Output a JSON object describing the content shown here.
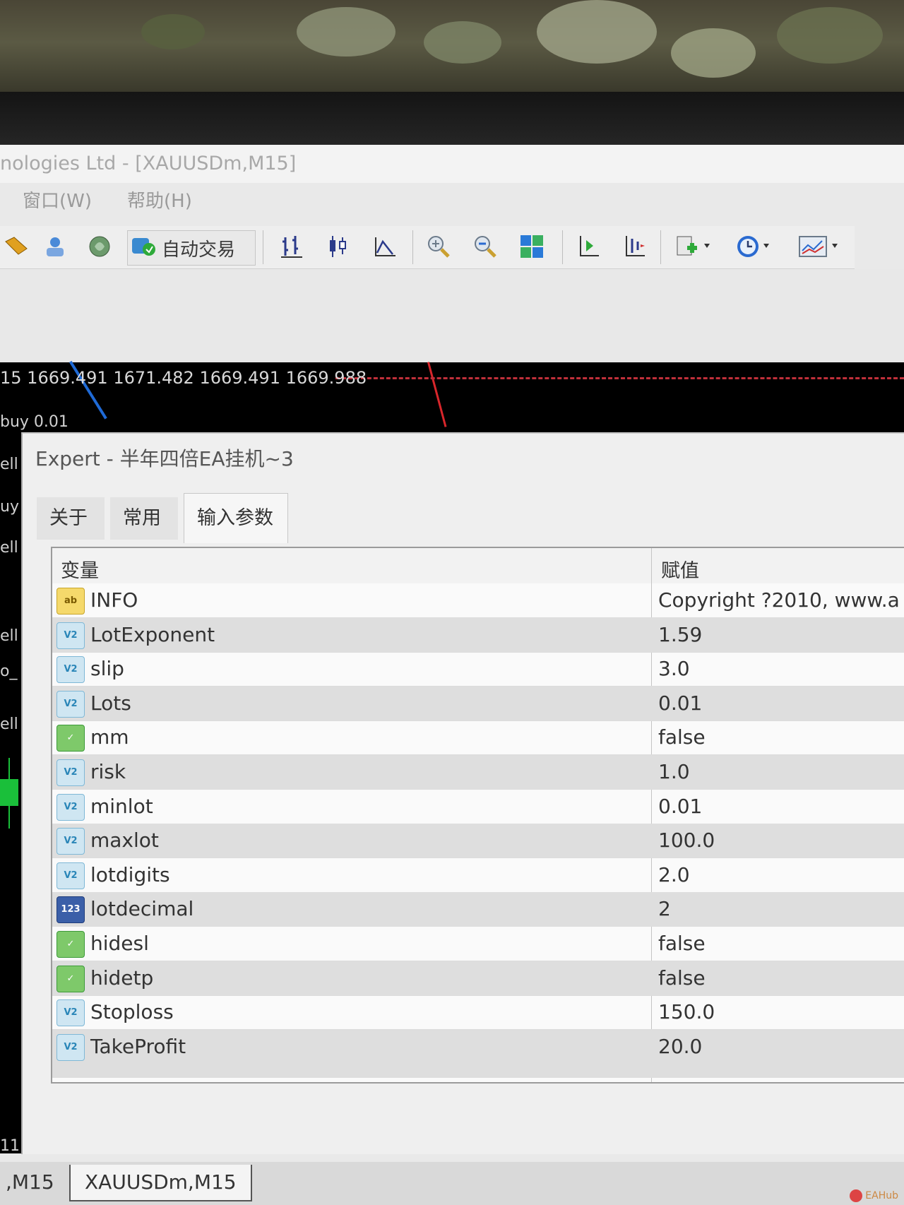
{
  "window": {
    "title": "nologies Ltd - [XAUUSDm,M15]",
    "menu": [
      "窗口(W)",
      "帮助(H)"
    ]
  },
  "toolbar": {
    "autotrade_label": "自动交易",
    "icons": [
      "folder-icon",
      "profile-icon",
      "globe-icon",
      "autotrade-icon",
      "bar-chart-icon",
      "candlestick-icon",
      "line-chart-icon",
      "zoom-in-icon",
      "zoom-out-icon",
      "tile-windows-icon",
      "chart-shift-icon",
      "autoscroll-icon",
      "new-order-icon",
      "clock-icon",
      "indicators-icon"
    ]
  },
  "chart": {
    "ohlc_text": "15 1669.491 1671.482 1669.491 1669.988",
    "labels": [
      "buy 0.01",
      "ell",
      "uy",
      "ell",
      "ell",
      "o_",
      "ell"
    ],
    "axis_label": "11"
  },
  "dialog": {
    "title": "Expert - 半年四倍EA挂机~3",
    "tabs": [
      "关于",
      "常用",
      "输入参数"
    ],
    "active_tab": "输入参数",
    "columns": [
      "变量",
      "赋值"
    ],
    "params": [
      {
        "type": "ab",
        "name": "INFO",
        "value": "Copyright ?2010, www.a"
      },
      {
        "type": "v2",
        "name": "LotExponent",
        "value": "1.59"
      },
      {
        "type": "v2",
        "name": "slip",
        "value": "3.0"
      },
      {
        "type": "v2",
        "name": "Lots",
        "value": "0.01"
      },
      {
        "type": "bool",
        "name": "mm",
        "value": "false"
      },
      {
        "type": "v2",
        "name": "risk",
        "value": "1.0"
      },
      {
        "type": "v2",
        "name": "minlot",
        "value": "0.01"
      },
      {
        "type": "v2",
        "name": "maxlot",
        "value": "100.0"
      },
      {
        "type": "v2",
        "name": "lotdigits",
        "value": "2.0"
      },
      {
        "type": "int",
        "name": "lotdecimal",
        "value": "2"
      },
      {
        "type": "bool",
        "name": "hidesl",
        "value": "false"
      },
      {
        "type": "bool",
        "name": "hidetp",
        "value": "false"
      },
      {
        "type": "v2",
        "name": "Stoploss",
        "value": "150.0"
      },
      {
        "type": "v2",
        "name": "TakeProfit",
        "value": "20.0"
      }
    ]
  },
  "bottom_tabs": [
    ",M15",
    "XAUUSDm,M15"
  ],
  "watermark": "EAHub"
}
